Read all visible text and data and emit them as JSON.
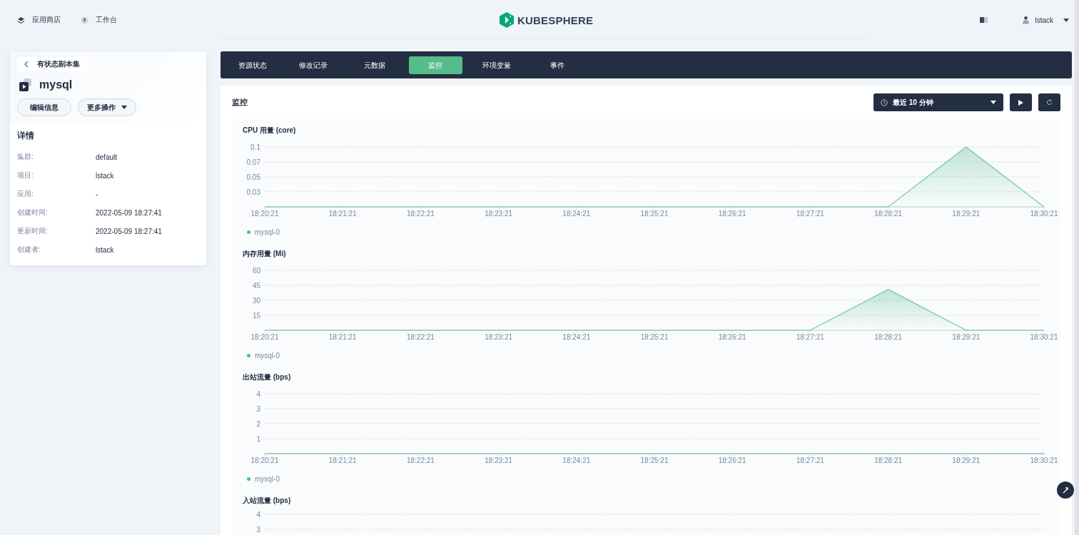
{
  "header": {
    "nav": [
      {
        "label": "应用商店",
        "kind": "store"
      },
      {
        "label": "工作台",
        "kind": "workbench"
      }
    ],
    "logo": "KUBESPHERE",
    "user": "lstack"
  },
  "sidebar": {
    "back": "有状态副本集",
    "name": "mysql",
    "buttons": [
      {
        "label": "编辑信息",
        "kind": "plain"
      },
      {
        "label": "更多操作",
        "kind": "dropdown"
      }
    ],
    "details_title": "详情",
    "details": [
      {
        "label": "集群:",
        "value": "default"
      },
      {
        "label": "项目:",
        "value": "lstack"
      },
      {
        "label": "应用:",
        "value": "-"
      },
      {
        "label": "创建时间:",
        "value": "2022-05-09 18:27:41"
      },
      {
        "label": "更新时间:",
        "value": "2022-05-09 18:27:41"
      },
      {
        "label": "创建者:",
        "value": "lstack"
      }
    ]
  },
  "tabs": [
    {
      "label": "资源状态",
      "selected": false
    },
    {
      "label": "修改记录",
      "selected": false
    },
    {
      "label": "元数据",
      "selected": false
    },
    {
      "label": "监控",
      "selected": true
    },
    {
      "label": "环境变量",
      "selected": false
    },
    {
      "label": "事件",
      "selected": false
    }
  ],
  "monitor": {
    "title": "监控",
    "time_range": "最近 10 分钟",
    "charts": [
      {
        "chart_data": {
          "type": "area",
          "grid": true,
          "title": "CPU 用量 (core)",
          "categories": [
            "18:20:21",
            "18:21:21",
            "18:22:21",
            "18:23:21",
            "18:24:21",
            "18:25:21",
            "18:26:21",
            "18:27:21",
            "18:28:21",
            "18:29:21",
            "18:30:21"
          ],
          "ylim": [
            0,
            0.1
          ],
          "yticks": [
            {
              "value": 0.025,
              "label": "0.03"
            },
            {
              "value": 0.05,
              "label": "0.05"
            },
            {
              "value": 0.075,
              "label": "0.07"
            },
            {
              "value": 0.1,
              "label": "0.1"
            }
          ],
          "series": [
            {
              "name": "mysql-0",
              "color": "#55bc8a",
              "values": [
                0,
                0,
                0,
                0,
                0,
                0,
                0,
                0,
                0,
                0.1,
                0
              ]
            }
          ]
        }
      },
      {
        "chart_data": {
          "type": "area",
          "grid": true,
          "title": "内存用量 (Mi)",
          "categories": [
            "18:20:21",
            "18:21:21",
            "18:22:21",
            "18:23:21",
            "18:24:21",
            "18:25:21",
            "18:26:21",
            "18:27:21",
            "18:28:21",
            "18:29:21",
            "18:30:21"
          ],
          "ylim": [
            0,
            60
          ],
          "yticks": [
            15,
            30,
            45,
            60
          ],
          "series": [
            {
              "name": "mysql-0",
              "color": "#55bc8a",
              "values": [
                0,
                0,
                0,
                0,
                0,
                0,
                0,
                0,
                41,
                0,
                0
              ]
            }
          ]
        }
      },
      {
        "chart_data": {
          "type": "line",
          "grid": true,
          "title": "出站流量 (bps)",
          "categories": [
            "18:20:21",
            "18:21:21",
            "18:22:21",
            "18:23:21",
            "18:24:21",
            "18:25:21",
            "18:26:21",
            "18:27:21",
            "18:28:21",
            "18:29:21",
            "18:30:21"
          ],
          "ylim": [
            0,
            4
          ],
          "yticks": [
            1,
            2,
            3,
            4
          ],
          "series": [
            {
              "name": "mysql-0",
              "color": "#55bc8a",
              "values": [
                0,
                0,
                0,
                0,
                0,
                0,
                0,
                0,
                0,
                0,
                0
              ]
            }
          ]
        }
      }
    ],
    "partial_chart": {
      "title": "入站流量 (bps)",
      "ytick_labels": [
        "4",
        "3"
      ]
    }
  }
}
